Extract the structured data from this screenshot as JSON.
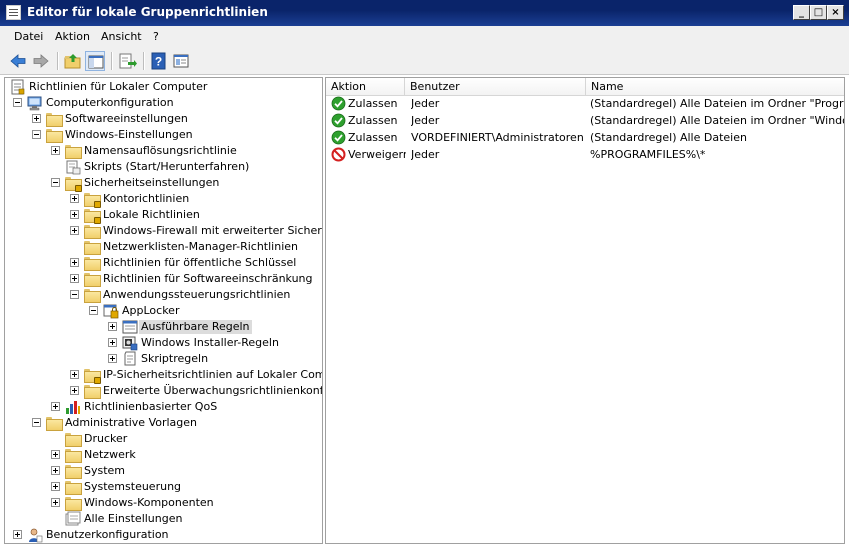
{
  "window": {
    "title": "Editor für lokale Gruppenrichtlinien",
    "min_glyph": "_",
    "max_glyph": "□",
    "close_glyph": "×"
  },
  "menu": {
    "items": [
      "Datei",
      "Aktion",
      "Ansicht",
      "?"
    ]
  },
  "toolbar": {
    "icons": [
      "back-arrow-icon",
      "forward-arrow-icon",
      "up-folder-icon",
      "show-hide-tree-icon",
      "export-list-icon",
      "help-icon",
      "properties-icon"
    ]
  },
  "tree": [
    {
      "label": "Richtlinien für Lokaler Computer",
      "icon": "policy-doc-icon",
      "level": 0,
      "expander": "none"
    },
    {
      "label": "Computerkonfiguration",
      "icon": "computer-icon",
      "level": 0,
      "expander": "minus"
    },
    {
      "label": "Softwareeinstellungen",
      "icon": "folder-icon",
      "level": 1,
      "expander": "plus"
    },
    {
      "label": "Windows-Einstellungen",
      "icon": "folder-icon",
      "level": 1,
      "expander": "minus"
    },
    {
      "label": "Namensauflösungsrichtlinie",
      "icon": "folder-icon",
      "level": 2,
      "expander": "plus"
    },
    {
      "label": "Skripts (Start/Herunterfahren)",
      "icon": "scripts-icon",
      "level": 2,
      "expander": "none"
    },
    {
      "label": "Sicherheitseinstellungen",
      "icon": "security-folder-icon",
      "level": 2,
      "expander": "minus"
    },
    {
      "label": "Kontorichtlinien",
      "icon": "security-folder-icon",
      "level": 3,
      "expander": "plus"
    },
    {
      "label": "Lokale Richtlinien",
      "icon": "security-folder-icon",
      "level": 3,
      "expander": "plus"
    },
    {
      "label": "Windows-Firewall mit erweiterter Sicherheit",
      "icon": "folder-icon",
      "level": 3,
      "expander": "plus"
    },
    {
      "label": "Netzwerklisten-Manager-Richtlinien",
      "icon": "folder-icon",
      "level": 3,
      "expander": "none"
    },
    {
      "label": "Richtlinien für öffentliche Schlüssel",
      "icon": "folder-icon",
      "level": 3,
      "expander": "plus"
    },
    {
      "label": "Richtlinien für Softwareeinschränkung",
      "icon": "folder-icon",
      "level": 3,
      "expander": "plus"
    },
    {
      "label": "Anwendungssteuerungsrichtlinien",
      "icon": "folder-icon",
      "level": 3,
      "expander": "minus"
    },
    {
      "label": "AppLocker",
      "icon": "applocker-icon",
      "level": 4,
      "expander": "minus"
    },
    {
      "label": "Ausführbare Regeln",
      "icon": "rules-window-icon",
      "level": 5,
      "expander": "plus",
      "selected": true
    },
    {
      "label": "Windows Installer-Regeln",
      "icon": "installer-icon",
      "level": 5,
      "expander": "plus"
    },
    {
      "label": "Skriptregeln",
      "icon": "script-rules-icon",
      "level": 5,
      "expander": "plus"
    },
    {
      "label": "IP-Sicherheitsrichtlinien auf Lokaler Compute",
      "icon": "security-folder-icon",
      "level": 3,
      "expander": "plus"
    },
    {
      "label": "Erweiterte Überwachungsrichtlinienkonfigura",
      "icon": "folder-icon",
      "level": 3,
      "expander": "plus"
    },
    {
      "label": "Richtlinienbasierter QoS",
      "icon": "qos-chart-icon",
      "level": 2,
      "expander": "plus"
    },
    {
      "label": "Administrative Vorlagen",
      "icon": "folder-icon",
      "level": 1,
      "expander": "minus"
    },
    {
      "label": "Drucker",
      "icon": "folder-icon",
      "level": 2,
      "expander": "none"
    },
    {
      "label": "Netzwerk",
      "icon": "folder-icon",
      "level": 2,
      "expander": "plus"
    },
    {
      "label": "System",
      "icon": "folder-icon",
      "level": 2,
      "expander": "plus"
    },
    {
      "label": "Systemsteuerung",
      "icon": "folder-icon",
      "level": 2,
      "expander": "plus"
    },
    {
      "label": "Windows-Komponenten",
      "icon": "folder-icon",
      "level": 2,
      "expander": "plus"
    },
    {
      "label": "Alle Einstellungen",
      "icon": "all-settings-icon",
      "level": 2,
      "expander": "none"
    },
    {
      "label": "Benutzerkonfiguration",
      "icon": "user-icon",
      "level": 0,
      "expander": "plus"
    }
  ],
  "list": {
    "columns": [
      "Aktion",
      "Benutzer",
      "Name"
    ],
    "rows": [
      {
        "aktion": "Zulassen",
        "benutzer": "Jeder",
        "name": "(Standardregel) Alle Dateien im Ordner \"Programme\"",
        "icon": "allow-check-icon"
      },
      {
        "aktion": "Zulassen",
        "benutzer": "Jeder",
        "name": "(Standardregel) Alle Dateien im Ordner \"Windows\"",
        "icon": "allow-check-icon"
      },
      {
        "aktion": "Zulassen",
        "benutzer": "VORDEFINIERT\\Administratoren",
        "name": "(Standardregel) Alle Dateien",
        "icon": "allow-check-icon"
      },
      {
        "aktion": "Verweigern",
        "benutzer": "Jeder",
        "name": "%PROGRAMFILES%\\*",
        "icon": "deny-circle-icon"
      }
    ]
  },
  "colors": {
    "titlebar": "#0a246a",
    "selection": "#dcdcdc",
    "allow": "#2ea02e",
    "deny": "#d42020",
    "folder": "#f1cf6b"
  }
}
